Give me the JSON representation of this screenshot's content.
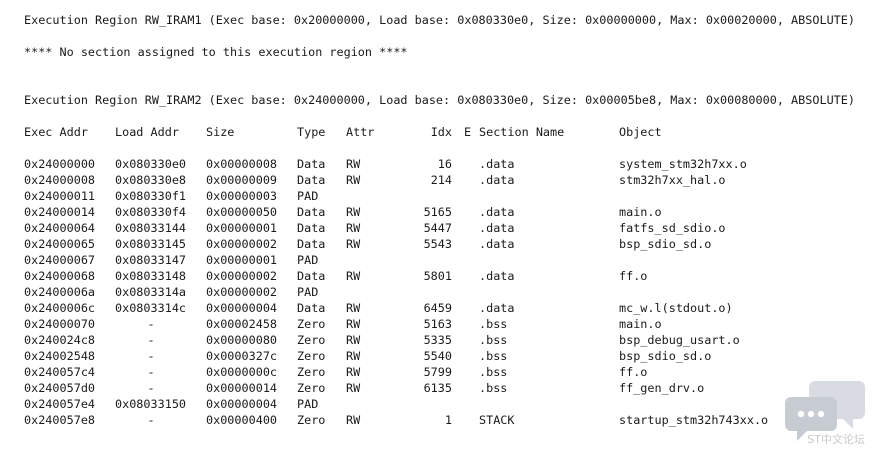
{
  "region1": {
    "header": "Execution Region RW_IRAM1 (Exec base: 0x20000000, Load base: 0x080330e0, Size: 0x00000000, Max: 0x00020000, ABSOLUTE)",
    "note": "**** No section assigned to this execution region ****"
  },
  "region2": {
    "header": "Execution Region RW_IRAM2 (Exec base: 0x24000000, Load base: 0x080330e0, Size: 0x00005be8, Max: 0x00080000, ABSOLUTE)"
  },
  "columns": {
    "exec": "Exec Addr",
    "load": "Load Addr",
    "size": "Size",
    "type": "Type",
    "attr": "Attr",
    "idx": "Idx",
    "e": "E",
    "sect": "Section Name",
    "obj": "Object"
  },
  "rows": [
    {
      "exec": "0x24000000",
      "load": "0x080330e0",
      "size": "0x00000008",
      "type": "Data",
      "attr": "RW",
      "idx": "16",
      "sect": ".data",
      "obj": "system_stm32h7xx.o"
    },
    {
      "exec": "0x24000008",
      "load": "0x080330e8",
      "size": "0x00000009",
      "type": "Data",
      "attr": "RW",
      "idx": "214",
      "sect": ".data",
      "obj": "stm32h7xx_hal.o"
    },
    {
      "exec": "0x24000011",
      "load": "0x080330f1",
      "size": "0x00000003",
      "type": "PAD",
      "attr": "",
      "idx": "",
      "sect": "",
      "obj": ""
    },
    {
      "exec": "0x24000014",
      "load": "0x080330f4",
      "size": "0x00000050",
      "type": "Data",
      "attr": "RW",
      "idx": "5165",
      "sect": ".data",
      "obj": "main.o"
    },
    {
      "exec": "0x24000064",
      "load": "0x08033144",
      "size": "0x00000001",
      "type": "Data",
      "attr": "RW",
      "idx": "5447",
      "sect": ".data",
      "obj": "fatfs_sd_sdio.o"
    },
    {
      "exec": "0x24000065",
      "load": "0x08033145",
      "size": "0x00000002",
      "type": "Data",
      "attr": "RW",
      "idx": "5543",
      "sect": ".data",
      "obj": "bsp_sdio_sd.o"
    },
    {
      "exec": "0x24000067",
      "load": "0x08033147",
      "size": "0x00000001",
      "type": "PAD",
      "attr": "",
      "idx": "",
      "sect": "",
      "obj": ""
    },
    {
      "exec": "0x24000068",
      "load": "0x08033148",
      "size": "0x00000002",
      "type": "Data",
      "attr": "RW",
      "idx": "5801",
      "sect": ".data",
      "obj": "ff.o"
    },
    {
      "exec": "0x2400006a",
      "load": "0x0803314a",
      "size": "0x00000002",
      "type": "PAD",
      "attr": "",
      "idx": "",
      "sect": "",
      "obj": ""
    },
    {
      "exec": "0x2400006c",
      "load": "0x0803314c",
      "size": "0x00000004",
      "type": "Data",
      "attr": "RW",
      "idx": "6459",
      "sect": ".data",
      "obj": "mc_w.l(stdout.o)"
    },
    {
      "exec": "0x24000070",
      "load": "-",
      "size": "0x00002458",
      "type": "Zero",
      "attr": "RW",
      "idx": "5163",
      "sect": ".bss",
      "obj": "main.o"
    },
    {
      "exec": "0x240024c8",
      "load": "-",
      "size": "0x00000080",
      "type": "Zero",
      "attr": "RW",
      "idx": "5335",
      "sect": ".bss",
      "obj": "bsp_debug_usart.o"
    },
    {
      "exec": "0x24002548",
      "load": "-",
      "size": "0x0000327c",
      "type": "Zero",
      "attr": "RW",
      "idx": "5540",
      "sect": ".bss",
      "obj": "bsp_sdio_sd.o"
    },
    {
      "exec": "0x240057c4",
      "load": "-",
      "size": "0x0000000c",
      "type": "Zero",
      "attr": "RW",
      "idx": "5799",
      "sect": ".bss",
      "obj": "ff.o"
    },
    {
      "exec": "0x240057d0",
      "load": "-",
      "size": "0x00000014",
      "type": "Zero",
      "attr": "RW",
      "idx": "6135",
      "sect": ".bss",
      "obj": "ff_gen_drv.o"
    },
    {
      "exec": "0x240057e4",
      "load": "0x08033150",
      "size": "0x00000004",
      "type": "PAD",
      "attr": "",
      "idx": "",
      "sect": "",
      "obj": ""
    },
    {
      "exec": "0x240057e8",
      "load": "-",
      "size": "0x00000400",
      "type": "Zero",
      "attr": "RW",
      "idx": "1",
      "sect": "STACK",
      "obj": "startup_stm32h743xx.o"
    }
  ],
  "watermark": {
    "text": "ST中文论坛",
    "icon": "chat-bubbles-icon",
    "color": "#c7ccd3"
  }
}
